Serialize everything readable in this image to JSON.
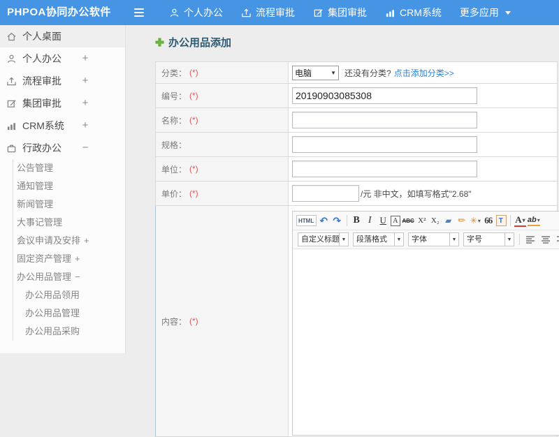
{
  "topbar": {
    "brand": "PHPOA协同办公软件",
    "menu": [
      {
        "label": "个人办公",
        "icon": "user-icon"
      },
      {
        "label": "流程审批",
        "icon": "share-icon"
      },
      {
        "label": "集团审批",
        "icon": "edit-icon"
      },
      {
        "label": "CRM系统",
        "icon": "chart-icon"
      },
      {
        "label": "更多应用",
        "icon": "caret-down-icon"
      }
    ]
  },
  "sidebar": {
    "items": [
      {
        "label": "个人桌面",
        "icon": "home-icon",
        "expand": ""
      },
      {
        "label": "个人办公",
        "icon": "user-icon",
        "expand": "+"
      },
      {
        "label": "流程审批",
        "icon": "share-icon",
        "expand": "+"
      },
      {
        "label": "集团审批",
        "icon": "edit-icon",
        "expand": "+"
      },
      {
        "label": "CRM系统",
        "icon": "chart-icon",
        "expand": "+"
      },
      {
        "label": "行政办公",
        "icon": "briefcase-icon",
        "expand": "−"
      }
    ],
    "subitems": [
      {
        "label": "公告管理",
        "expand": ""
      },
      {
        "label": "通知管理",
        "expand": ""
      },
      {
        "label": "新闻管理",
        "expand": ""
      },
      {
        "label": "大事记管理",
        "expand": ""
      },
      {
        "label": "会议申请及安排",
        "expand": "+"
      },
      {
        "label": "固定资产管理",
        "expand": "+"
      },
      {
        "label": "办公用品管理",
        "expand": "−"
      }
    ],
    "subsubitems": [
      "办公用品领用",
      "办公用品管理",
      "办公用品采购"
    ]
  },
  "form": {
    "title": "办公用品添加",
    "rows": [
      {
        "label": "分类：",
        "req": "(*)"
      },
      {
        "label": "编号：",
        "req": "(*)"
      },
      {
        "label": "名称：",
        "req": "(*)"
      },
      {
        "label": "规格：",
        "req": ""
      },
      {
        "label": "单位：",
        "req": "(*)"
      },
      {
        "label": "单价：",
        "req": "(*)"
      },
      {
        "label": "内容：",
        "req": "(*)"
      }
    ],
    "category": {
      "selected": "电脑",
      "caret": "▼",
      "hint": "还没有分类?",
      "link": "点击添加分类>>"
    },
    "number": {
      "value": "20190903085308"
    },
    "price": {
      "hint": "/元 非中文，如填写格式\"2.68\""
    }
  },
  "editor": {
    "row1": [
      {
        "name": "html-source-button",
        "glyph": "HTML",
        "kind": "k-html"
      },
      {
        "name": "undo-icon",
        "glyph": "↶",
        "kind": "k-blue"
      },
      {
        "name": "redo-icon",
        "glyph": "↷",
        "kind": "k-blue"
      },
      {
        "name": "toolbar-separator",
        "glyph": "",
        "kind": "k-sep"
      },
      {
        "name": "bold-button",
        "glyph": "B",
        "kind": "k-b"
      },
      {
        "name": "italic-button",
        "glyph": "I",
        "kind": "k-i"
      },
      {
        "name": "underline-button",
        "glyph": "U",
        "kind": "k-u"
      },
      {
        "name": "font-style-button",
        "glyph": "A",
        "kind": "k-box"
      },
      {
        "name": "strikethrough-button",
        "glyph": "ABC",
        "kind": "k-strike"
      },
      {
        "name": "superscript-button",
        "glyph": "X²",
        "kind": "k-sup"
      },
      {
        "name": "subscript-button",
        "glyph": "X₂",
        "kind": "k-sub"
      },
      {
        "name": "remove-format-icon",
        "glyph": "▰",
        "kind": "k-eraser"
      },
      {
        "name": "format-brush-icon",
        "glyph": "✏",
        "kind": "k-brush"
      },
      {
        "name": "quick-format-icon",
        "glyph": "✳",
        "kind": "k-spark",
        "caret": "▾"
      },
      {
        "name": "blockquote-button",
        "glyph": "66",
        "kind": "k-quote"
      },
      {
        "name": "paste-as-text-button",
        "glyph": "T",
        "kind": "k-paste"
      },
      {
        "name": "toolbar-separator",
        "glyph": "",
        "kind": "k-sep"
      },
      {
        "name": "font-color-button",
        "glyph": "A",
        "kind": "k-fontcolor",
        "caret": "▾"
      },
      {
        "name": "highlight-color-button",
        "glyph": "ab",
        "kind": "k-hilite",
        "caret": "▾"
      }
    ],
    "row2": [
      {
        "name": "heading-select",
        "label": "自定义标题",
        "caret": "▼"
      },
      {
        "name": "paragraph-format-select",
        "label": "段落格式",
        "caret": "▼"
      },
      {
        "name": "font-family-select",
        "label": "字体",
        "caret": "▼"
      },
      {
        "name": "font-size-select",
        "label": "字号",
        "caret": "▼"
      }
    ]
  },
  "colors": {
    "topbar_blue": "#4695e4",
    "title_teal": "#2f5a73",
    "required_red": "#e05a5a",
    "link_blue": "#2b82d9",
    "plus_green": "#6abe3c"
  }
}
